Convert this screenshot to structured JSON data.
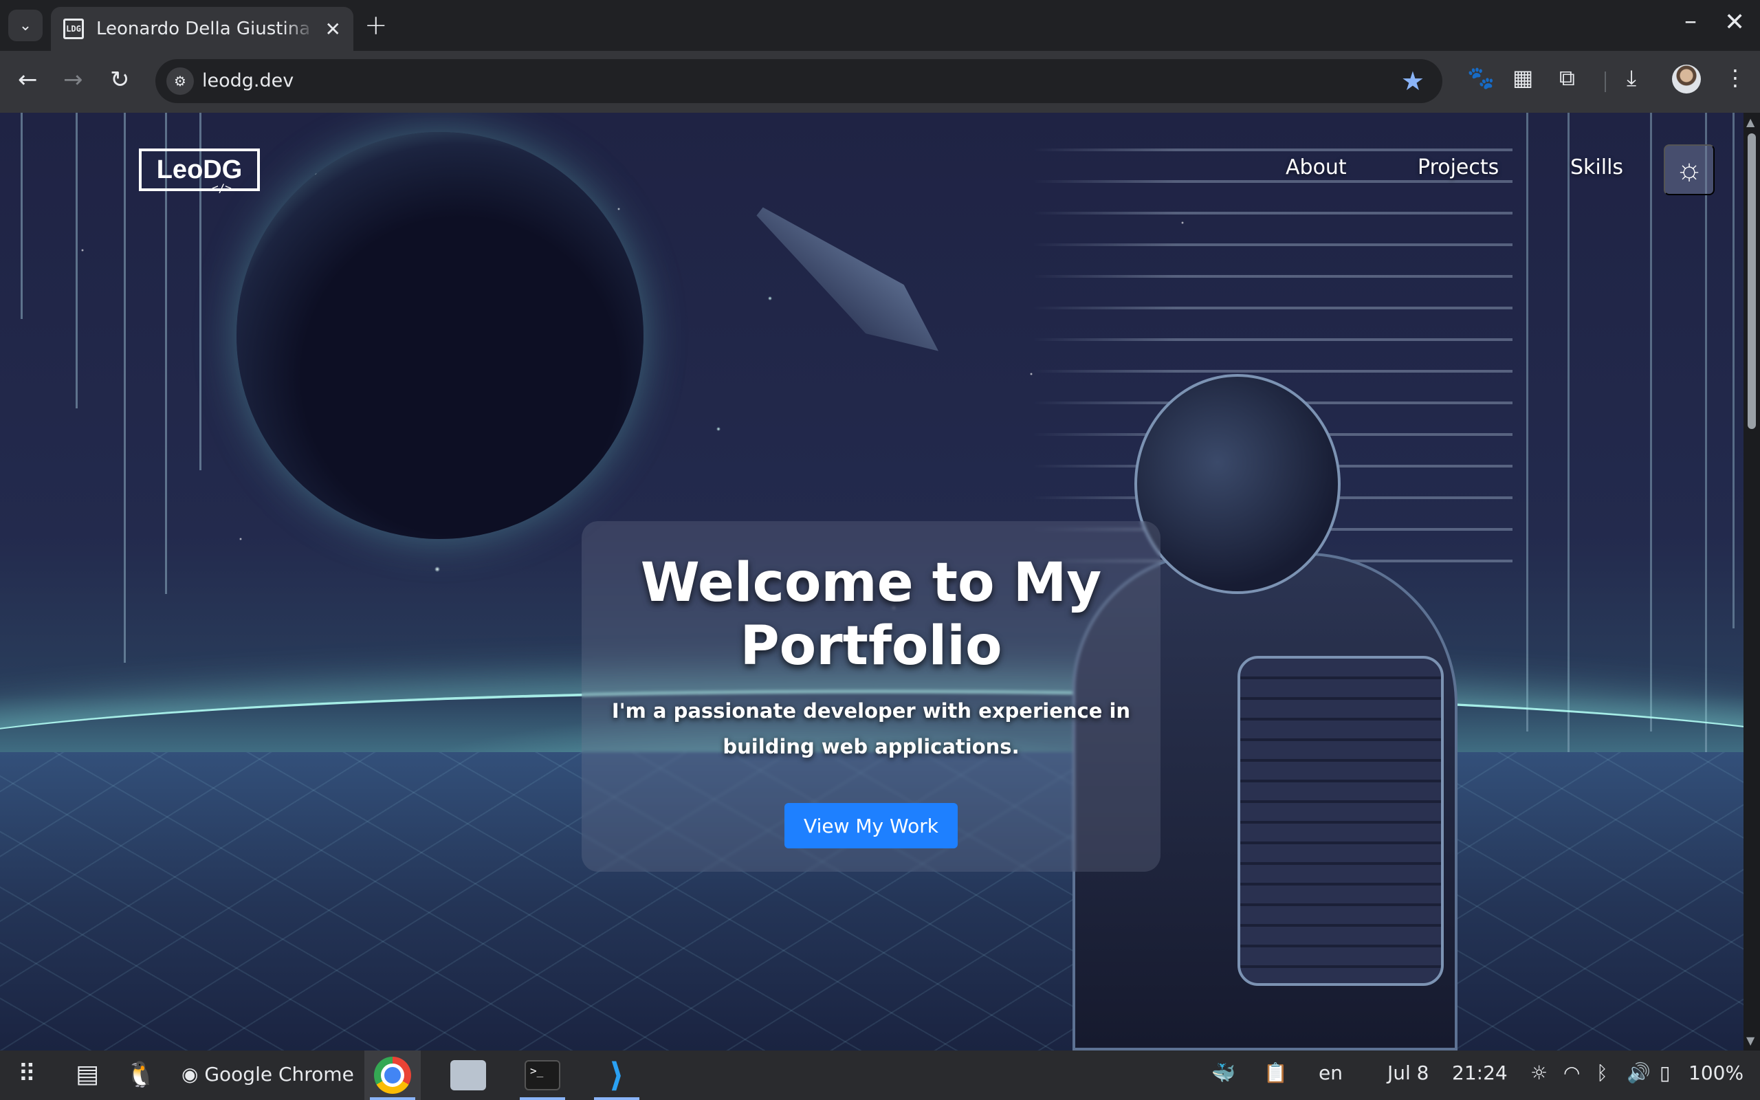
{
  "browser": {
    "tab_title": "Leonardo Della Giustina - Portfolio",
    "tab_favicon_text": "LDG",
    "url": "leodg.dev",
    "icons": {
      "tab_search": "chevron-down-icon",
      "new_tab": "plus-icon",
      "close_tab": "close-icon",
      "back": "arrow-left-icon",
      "forward": "arrow-right-icon",
      "reload": "reload-icon",
      "site_info": "tune-icon",
      "bookmark": "star-icon",
      "extensions": "puzzle-icon",
      "downloads": "download-icon",
      "menu": "kebab-icon"
    },
    "accent_color": "#8ab4f8"
  },
  "site": {
    "logo_text": "LeoDG",
    "logo_sub": "</>",
    "nav": [
      "About",
      "Projects",
      "Skills"
    ],
    "theme_toggle_icon": "sun-icon"
  },
  "hero": {
    "title": "Welcome to My Portfolio",
    "subtitle": "I'm a passionate developer with experience in building web applications.",
    "cta_label": "View My Work",
    "cta_color": "#1e80ff"
  },
  "taskbar": {
    "launcher_icon": "app-grid-icon",
    "chrome_label": "Google Chrome",
    "language": "en",
    "date": "Jul 8",
    "time": "21:24",
    "battery": "100%",
    "apps": [
      "chrome",
      "files",
      "terminal",
      "vscode"
    ]
  }
}
